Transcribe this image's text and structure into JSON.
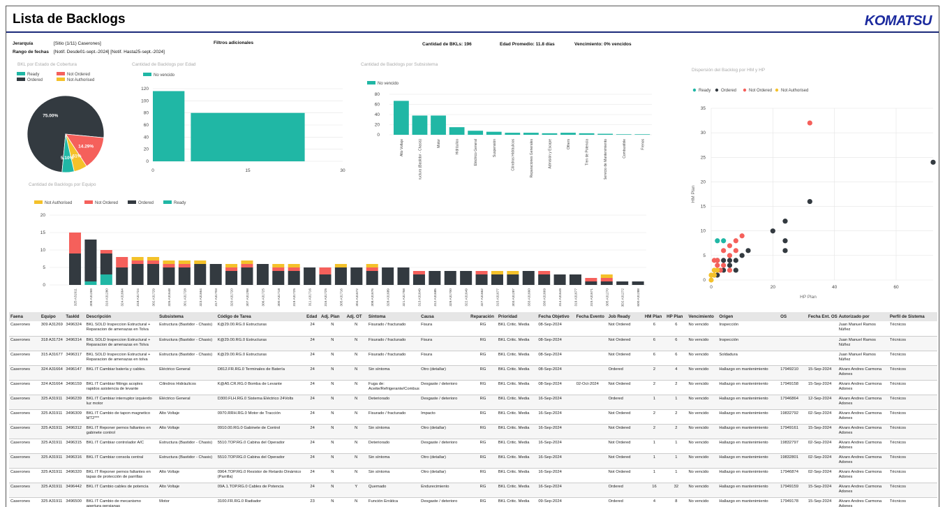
{
  "header": {
    "title": "Lista de Backlogs",
    "logo": "KOMATSU"
  },
  "filters": {
    "jerarquia_label": "Jerarquía",
    "jerarquia_value": "[Sitio (1/11) Caserones]",
    "rango_label": "Rango de fechas",
    "rango_value": "[Notif. Desde01-sept.-2024] [Notif. Hasta25-sept.-2024]",
    "adicionales_label": "Filtros adicionales",
    "cantidad": "Cantidad de BKLs: 196",
    "edad": "Edad Promedio: 11.8 días",
    "vencimiento": "Vencimiento: 0% vencidos"
  },
  "colors": {
    "ready": "#20b7a5",
    "not_ordered": "#f5605b",
    "ordered": "#333a40",
    "not_authorised": "#f4c12a"
  },
  "charts": {
    "pie": {
      "title": "BKL por Estado de Cobertura",
      "legend": [
        "Ready",
        "Not Ordered",
        "Ordered",
        "Not Authorised"
      ],
      "chart_data": {
        "type": "pie",
        "labels": [
          "Ordered",
          "Not Ordered",
          "Not Authorised",
          "Ready"
        ],
        "values": [
          75.0,
          14.29,
          5.61,
          5.1
        ],
        "data_labels": [
          "75.00%",
          "14.29%",
          "5.61%",
          "5.10%"
        ]
      }
    },
    "edad": {
      "title": "Cantidad de Backlogs por Edad",
      "legend": [
        "No vencido"
      ],
      "chart_data": {
        "type": "bar",
        "bins": [
          [
            0,
            5
          ],
          [
            6,
            24
          ]
        ],
        "values": [
          116,
          80
        ],
        "xlim": [
          0,
          30
        ],
        "xticks": [
          "0",
          "15",
          "30"
        ],
        "ylim": [
          0,
          120
        ],
        "yticks": [
          "0",
          "20",
          "40",
          "60",
          "80",
          "100",
          "120"
        ]
      }
    },
    "subsistema": {
      "title": "Cantidad de Backlogs por Subsistema",
      "legend": [
        "No vencido"
      ],
      "chart_data": {
        "type": "bar",
        "categories": [
          "Alto Voltaje",
          "Estructura (Bastidor - Chasis)",
          "Motor",
          "Hidráulico",
          "Eléctrico General",
          "Suspensión",
          "Cilindros Hidráulicos",
          "Reparaciones Generales",
          "Admisión y Escape",
          "Others",
          "Tren de Potencia",
          "Servicio de Mantenimiento",
          "Combustible",
          "Frenos"
        ],
        "values": [
          67,
          38,
          38,
          15,
          8,
          6,
          4,
          4,
          3,
          4,
          3,
          2,
          1,
          1
        ],
        "ylim": [
          0,
          80
        ],
        "yticks": [
          "0",
          "20",
          "40",
          "60",
          "80"
        ]
      }
    },
    "equipo": {
      "title": "Cantidad de Backlogs por Equipo",
      "legend": [
        "Not Authorised",
        "Not Ordered",
        "Ordered",
        "Ready"
      ],
      "chart_data": {
        "type": "bar",
        "categories": [
          "325 A31911",
          "309 A31269",
          "310 A31280",
          "324 A31664",
          "318 A31724",
          "302 A31729",
          "326 A31648",
          "301 A31728",
          "323 A31664",
          "317 A31703",
          "320 A31720",
          "307 A31298",
          "306 A31725",
          "300 A31718",
          "319 A31725",
          "311 A31716",
          "316 A31725",
          "305 A31716",
          "304 A31672",
          "308 A31676",
          "328 A31689",
          "321 A31758",
          "313 A31649",
          "312 A31685",
          "329 A31700",
          "322 A31649",
          "327 A31662",
          "315 A31677",
          "303 A31287",
          "333 A31660",
          "330 A31669",
          "314 A31649",
          "319 A31677",
          "315 A31671",
          "305 A31270",
          "3D2 A31272",
          "600 A31288"
        ],
        "series": [
          {
            "name": "Ready",
            "values": [
              0,
              1,
              3,
              0,
              0,
              0,
              0,
              0,
              0,
              0,
              0,
              0,
              0,
              0,
              0,
              0,
              0,
              0,
              0,
              0,
              0,
              0,
              0,
              0,
              0,
              0,
              0,
              0,
              0,
              0,
              0,
              0,
              0,
              0,
              0,
              0,
              0
            ]
          },
          {
            "name": "Ordered",
            "values": [
              9,
              12,
              6,
              5,
              6,
              6,
              5,
              5,
              6,
              6,
              4,
              5,
              6,
              4,
              4,
              5,
              3,
              5,
              5,
              4,
              5,
              5,
              3,
              4,
              4,
              4,
              3,
              3,
              3,
              4,
              3,
              3,
              3,
              1,
              1,
              1,
              1
            ]
          },
          {
            "name": "Not Ordered",
            "values": [
              6,
              0,
              1,
              3,
              1,
              1,
              1,
              1,
              0,
              0,
              1,
              1,
              0,
              1,
              1,
              0,
              2,
              0,
              0,
              1,
              0,
              0,
              1,
              0,
              0,
              0,
              1,
              0,
              0,
              0,
              1,
              0,
              0,
              1,
              1,
              0,
              0
            ]
          },
          {
            "name": "Not Authorised",
            "values": [
              0,
              0,
              0,
              0,
              1,
              1,
              1,
              1,
              1,
              0,
              1,
              1,
              0,
              1,
              1,
              0,
              0,
              1,
              0,
              1,
              0,
              0,
              0,
              0,
              0,
              0,
              0,
              1,
              1,
              0,
              0,
              0,
              0,
              0,
              1,
              0,
              0
            ]
          }
        ],
        "ylim": [
          0,
          20
        ],
        "yticks": [
          "0",
          "5",
          "10",
          "15",
          "20"
        ]
      }
    },
    "scatter": {
      "title": "Dispersión del Backlog por HM y HP",
      "legend": [
        "Ready",
        "Ordered",
        "Not Ordered",
        "Not Authorised"
      ],
      "xlabel": "HP Plan",
      "ylabel": "HM Plan",
      "chart_data": {
        "type": "scatter",
        "xlim": [
          0,
          72
        ],
        "ylim": [
          0,
          35
        ],
        "xticks": [
          "0",
          "20",
          "40",
          "60"
        ],
        "yticks": [
          "0",
          "5",
          "10",
          "15",
          "20",
          "25",
          "30",
          "35"
        ],
        "series": [
          {
            "name": "Ready",
            "points": [
              [
                2,
                8
              ],
              [
                4,
                8
              ]
            ]
          },
          {
            "name": "Ordered",
            "points": [
              [
                72,
                24
              ],
              [
                32,
                16
              ],
              [
                24,
                12
              ],
              [
                20,
                10
              ],
              [
                24,
                8
              ],
              [
                24,
                6
              ],
              [
                12,
                6
              ],
              [
                10,
                5
              ],
              [
                8,
                4
              ],
              [
                6,
                3
              ],
              [
                4,
                2
              ],
              [
                2,
                1
              ],
              [
                1,
                1
              ],
              [
                2,
                4
              ],
              [
                4,
                4
              ],
              [
                8,
                2
              ],
              [
                6,
                4
              ]
            ]
          },
          {
            "name": "Not Ordered",
            "points": [
              [
                32,
                32
              ],
              [
                10,
                9
              ],
              [
                8,
                8
              ],
              [
                6,
                7
              ],
              [
                4,
                6
              ],
              [
                8,
                6
              ],
              [
                6,
                5
              ],
              [
                2,
                4
              ],
              [
                4,
                3
              ],
              [
                2,
                2
              ],
              [
                3,
                2
              ],
              [
                1,
                4
              ],
              [
                6,
                2
              ],
              [
                2,
                3
              ]
            ]
          },
          {
            "name": "Not Authorised",
            "points": [
              [
                1,
                1
              ],
              [
                0,
                0
              ],
              [
                2,
                2
              ],
              [
                1,
                2
              ],
              [
                0,
                1
              ]
            ]
          }
        ]
      }
    }
  },
  "table": {
    "headers": [
      "Faena",
      "Equipo",
      "TaskId",
      "Descripción",
      "Subsistema",
      "Código de Tarea",
      "Edad",
      "Adj. Plan",
      "Adj. OT",
      "Síntoma",
      "Causa",
      "Reparación",
      "Prioridad",
      "Fecha Objetivo",
      "Fecha Evento",
      "Job Ready",
      "HM Plan",
      "HP Plan",
      "Vencimiento",
      "Origen",
      "OS",
      "Fecha Ent. OS",
      "Autorizado por",
      "Perfil de Sistema"
    ],
    "rows": [
      [
        "Caserones",
        "309 A31269",
        "3496324",
        "BKL SOLD Inspeccion Estructural + Reparacion de amenazas en Tolva",
        "Estructura (Bastidor - Chasis)",
        "K@29.00.RG.0 Estructuras",
        "24",
        "N",
        "N",
        "Fisurado / fracturado",
        "Fisura",
        "RG",
        "BKL Critic. Media",
        "08-Sep-2024",
        "",
        "Not Ordered",
        "6",
        "6",
        "No vencido",
        "Inspección",
        "",
        "",
        "Juan Manuel Ramos Núñez",
        "Técnicos"
      ],
      [
        "Caserones",
        "318 A31724",
        "3496314",
        "BKL SOLD Inspeccion Estructural + Reparacion de amenazas en Tolva",
        "Estructura (Bastidor - Chasis)",
        "K@29.00.RG.0 Estructuras",
        "24",
        "N",
        "N",
        "Fisurado / fracturado",
        "Fisura",
        "RG",
        "BKL Critic. Media",
        "08-Sep-2024",
        "",
        "Not Ordered",
        "6",
        "6",
        "No vencido",
        "Inspección",
        "",
        "",
        "Juan Manuel Ramos Núñez",
        "Técnicos"
      ],
      [
        "Caserones",
        "315 A31677",
        "3496317",
        "BKL SOLD Inspeccion Estructural + Reparacion de amenazas en tolva",
        "Estructura (Bastidor - Chasis)",
        "K@29.00.RG.0 Estructuras",
        "24",
        "N",
        "N",
        "Fisurado / fracturado",
        "Fisura",
        "RG",
        "BKL Critic. Media",
        "08-Sep-2024",
        "",
        "Not Ordered",
        "6",
        "6",
        "No vencido",
        "Soldadura",
        "",
        "",
        "Juan Manuel Ramos Núñez",
        "Técnicos"
      ],
      [
        "Caserones",
        "324 A31664",
        "3496147",
        "BKL IT Cambiar batería y cables.",
        "Eléctrico General",
        "D812.FR.RG.0 Terminales de Batería",
        "24",
        "N",
        "N",
        "Sin síntoma",
        "Otro (detallar)",
        "RG",
        "BKL Critic. Media",
        "08-Sep-2024",
        "",
        "Ordered",
        "2",
        "4",
        "No vencido",
        "Hallazgo en mantenimiento",
        "17949210",
        "15-Sep-2024",
        "Alvaro Andres Carmona Adones",
        "Técnicos"
      ],
      [
        "Caserones",
        "324 A31664",
        "3496159",
        "BKL IT Cambiar fittings acoples rapidos asistencia de levante",
        "Cilindros Hidráulicos",
        "K@A5.CR.RG.0 Bomba de Levante",
        "24",
        "N",
        "N",
        "Fuga de: Aceite/Refrigerante/Combustible/Aire/Gas/",
        "Desgaste / deterioro",
        "RG",
        "BKL Critic. Media",
        "08-Sep-2024",
        "02-Oct-2024",
        "Not Ordered",
        "2",
        "2",
        "No vencido",
        "Hallazgo en mantenimiento",
        "17949158",
        "15-Sep-2024",
        "Alvaro Andres Carmona Adones",
        "Técnicos"
      ],
      [
        "Caserones",
        "325 A31911",
        "3496239",
        "BKL IT Cambiar interruptor izquierdo luz motor",
        "Eléctrico General",
        "D300.FLH.RG.0 Sistema Eléctrico 24Volts",
        "24",
        "N",
        "N",
        "Deteriorado",
        "Desgaste / deterioro",
        "RG",
        "BKL Critic. Media",
        "16-Sep-2024",
        "",
        "Ordered",
        "1",
        "1",
        "No vencido",
        "Hallazgo en mantenimiento",
        "17946864",
        "12-Sep-2024",
        "Alvaro Andres Carmona Adones",
        "Técnicos"
      ],
      [
        "Caserones",
        "325 A31911",
        "3496309",
        "BKL IT Cambio de tapon magnetico MT2***",
        "Alto Voltaje",
        "0970.RRH.RG.0 Motor de Tracción",
        "24",
        "N",
        "N",
        "Fisurado / fracturado",
        "Impacto",
        "RG",
        "BKL Critic. Media",
        "16-Sep-2024",
        "",
        "Not Ordered",
        "2",
        "2",
        "No vencido",
        "Hallazgo en mantenimiento",
        "19832792",
        "02-Sep-2024",
        "Alvaro Andres Carmona Adones",
        "Técnicos"
      ],
      [
        "Caserones",
        "325 A31911",
        "3496312",
        "BKL IT Reponer pernos faltantes en gabinete control",
        "Alto Voltaje",
        "0910.00.RG.0 Gabinete de Control",
        "24",
        "N",
        "N",
        "Sin síntoma",
        "Otro (detallar)",
        "RG",
        "BKL Critic. Media",
        "16-Sep-2024",
        "",
        "Not Ordered",
        "2",
        "2",
        "No vencido",
        "Hallazgo en mantenimiento",
        "17949161",
        "15-Sep-2024",
        "Alvaro Andres Carmona Adones",
        "Técnicos"
      ],
      [
        "Caserones",
        "325 A31911",
        "3496315",
        "BKL IT Cambiar controlador A/C",
        "Estructura (Bastidor - Chasis)",
        "5510.TOP.RG.0 Cabina del Operador",
        "24",
        "N",
        "N",
        "Deteriorado",
        "Desgaste / deterioro",
        "RG",
        "BKL Critic. Media",
        "16-Sep-2024",
        "",
        "Not Ordered",
        "1",
        "1",
        "No vencido",
        "Hallazgo en mantenimiento",
        "19832797",
        "02-Sep-2024",
        "Alvaro Andres Carmona Adones",
        "Técnicos"
      ],
      [
        "Caserones",
        "325 A31911",
        "3496316",
        "BKL IT Cambiar consola central",
        "Estructura (Bastidor - Chasis)",
        "5510.TOP.RG.0 Cabina del Operador",
        "24",
        "N",
        "N",
        "Sin síntoma",
        "Otro (detallar)",
        "RG",
        "BKL Critic. Media",
        "16-Sep-2024",
        "",
        "Not Ordered",
        "1",
        "1",
        "No vencido",
        "Hallazgo en mantenimiento",
        "19832801",
        "02-Sep-2024",
        "Alvaro Andres Carmona Adones",
        "Técnicos"
      ],
      [
        "Caserones",
        "325 A31911",
        "3496320",
        "BKL IT Reponer pernos faltantes en tapas de protección de parrillas",
        "Alto Voltaje",
        "0964.TOP.RG.0 Resistor de Retardo Dinámico (Parrilla)",
        "24",
        "N",
        "N",
        "Sin síntoma",
        "Otro (detallar)",
        "RG",
        "BKL Critic. Media",
        "16-Sep-2024",
        "",
        "Not Ordered",
        "1",
        "1",
        "No vencido",
        "Hallazgo en mantenimiento",
        "17946874",
        "02-Sep-2024",
        "Alvaro Andres Carmona Adones",
        "Técnicos"
      ],
      [
        "Caserones",
        "325 A31911",
        "3496442",
        "BKL IT Cambio cables de potencia",
        "Alto Voltaje",
        "09A.1.TOP.RG.0 Cables de Potencia",
        "24",
        "N",
        "Y",
        "Quemado",
        "Endurecimiento",
        "RG",
        "BKL Critic. Media",
        "16-Sep-2024",
        "",
        "Ordered",
        "16",
        "32",
        "No vencido",
        "Hallazgo en mantenimiento",
        "17949159",
        "15-Sep-2024",
        "Alvaro Andres Carmona Adones",
        "Técnicos"
      ],
      [
        "Caserones",
        "325 A31911",
        "3496500",
        "BKL IT Cambio de mecanismo apertura persianas",
        "Motor",
        "3100.FR.RG.0 Radiador",
        "23",
        "N",
        "N",
        "Función Errática",
        "Desgaste / deterioro",
        "RG",
        "BKL Critic. Media",
        "09-Sep-2024",
        "",
        "Ordered",
        "4",
        "8",
        "No vencido",
        "Hallazgo en mantenimiento",
        "17949178",
        "15-Sep-2024",
        "Alvaro Andres Carmona Adones",
        "Técnicos"
      ]
    ]
  }
}
